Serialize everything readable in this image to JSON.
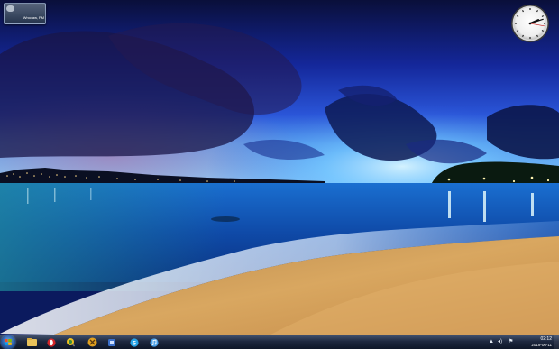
{
  "desktop": {
    "wallpaper": "night-beach-wallpaper",
    "colors": {
      "sky_top": "#0a1040",
      "sky_mid": "#1736b0",
      "horizon_glow": "#7fd0ff",
      "sea": "#0f4fa8",
      "sand": "#d9a45a"
    }
  },
  "weather_gadget": {
    "city": "Wrocław, PM",
    "icon": "cloud-icon"
  },
  "clock_gadget": {
    "hour": 2,
    "minute": 12,
    "icon": "analog-clock-icon"
  },
  "taskbar": {
    "start_icon": "windows-start-icon",
    "pinned": [
      {
        "name": "internet-explorer-icon",
        "color": "#2a8de0"
      },
      {
        "name": "file-explorer-icon",
        "color": "#e8c25a"
      },
      {
        "name": "opera-icon",
        "color": "#d4262a"
      },
      {
        "name": "search-gadget-icon",
        "color": "#f0c020"
      },
      {
        "name": "winamp-icon",
        "color": "#e0a020"
      },
      {
        "name": "utility-icon",
        "color": "#3b6fc9"
      },
      {
        "name": "skype-icon",
        "color": "#26a4e8"
      },
      {
        "name": "itunes-icon",
        "color": "#4aa0e8"
      }
    ],
    "tray": {
      "time": "02:12",
      "date": "2019-06-11",
      "icons": [
        "network-icon",
        "volume-icon",
        "flag-icon"
      ]
    }
  }
}
